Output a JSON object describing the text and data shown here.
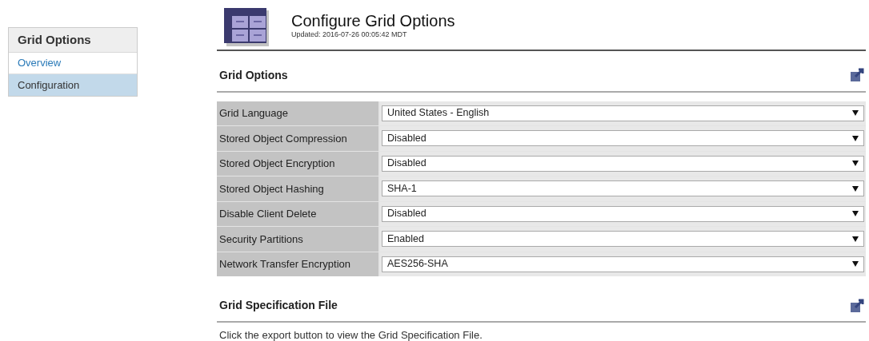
{
  "sidebar": {
    "title": "Grid Options",
    "items": [
      {
        "label": "Overview",
        "selected": false
      },
      {
        "label": "Configuration",
        "selected": true
      }
    ]
  },
  "header": {
    "title": "Configure Grid Options",
    "updated": "Updated: 2016-07-26 00:05:42 MDT"
  },
  "options_section": {
    "title": "Grid Options",
    "rows": [
      {
        "label": "Grid Language",
        "value": "United States - English"
      },
      {
        "label": "Stored Object Compression",
        "value": "Disabled"
      },
      {
        "label": "Stored Object Encryption",
        "value": "Disabled"
      },
      {
        "label": "Stored Object Hashing",
        "value": "SHA-1"
      },
      {
        "label": "Disable Client Delete",
        "value": "Disabled"
      },
      {
        "label": "Security Partitions",
        "value": "Enabled"
      },
      {
        "label": "Network Transfer Encryption",
        "value": "AES256-SHA"
      }
    ]
  },
  "spec_section": {
    "title": "Grid Specification File",
    "text": "Click the export button to view the Grid Specification File."
  }
}
